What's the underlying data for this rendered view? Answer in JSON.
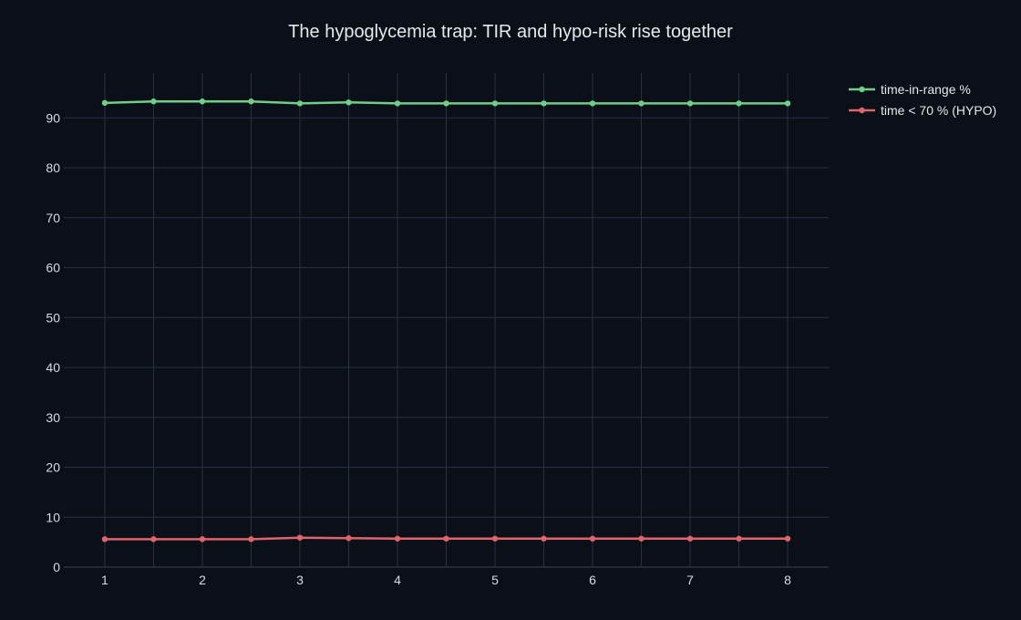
{
  "chart_data": {
    "type": "line",
    "title": "The hypoglycemia trap: TIR and hypo-risk rise together",
    "xlabel": "",
    "ylabel": "",
    "x": [
      1,
      1.5,
      2,
      2.5,
      3,
      3.5,
      4,
      4.5,
      5,
      5.5,
      6,
      6.5,
      7,
      7.5,
      8
    ],
    "xticks": [
      1,
      2,
      3,
      4,
      5,
      6,
      7,
      8
    ],
    "yticks": [
      0,
      10,
      20,
      30,
      40,
      50,
      60,
      70,
      80,
      90
    ],
    "xlim": [
      0.58,
      8.42
    ],
    "ylim": [
      0,
      99
    ],
    "grid": true,
    "legend_position": "top-right",
    "series": [
      {
        "name": "time-in-range %",
        "color": "#6fcf8a",
        "values": [
          93.0,
          93.3,
          93.3,
          93.3,
          92.9,
          93.1,
          92.9,
          92.9,
          92.9,
          92.9,
          92.9,
          92.9,
          92.9,
          92.9,
          92.9
        ]
      },
      {
        "name": "time < 70 % (HYPO)",
        "color": "#e0646e",
        "values": [
          5.6,
          5.6,
          5.6,
          5.6,
          5.9,
          5.8,
          5.7,
          5.7,
          5.7,
          5.7,
          5.7,
          5.7,
          5.7,
          5.7,
          5.7
        ]
      }
    ]
  }
}
